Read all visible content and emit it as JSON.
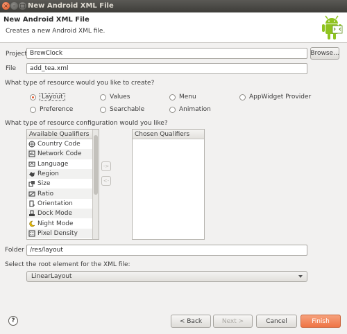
{
  "window": {
    "title": "New Android XML File",
    "close_glyph": "×",
    "min_glyph": "–",
    "max_glyph": "□"
  },
  "header": {
    "title": "New Android XML File",
    "description": "Creates a new Android XML file."
  },
  "project": {
    "label": "Project",
    "value": "BrewClock",
    "browse_label": "Browse..."
  },
  "file": {
    "label": "File",
    "value": "add_tea.xml"
  },
  "resource_type": {
    "prompt": "What type of resource would you like to create?",
    "options": [
      "Layout",
      "Values",
      "Menu",
      "AppWidget Provider",
      "Preference",
      "Searchable",
      "Animation"
    ],
    "selected": "Layout"
  },
  "qualifiers": {
    "prompt": "What type of resource configuration would you like?",
    "available_header": "Available Qualifiers",
    "chosen_header": "Chosen Qualifiers",
    "available": [
      "Country Code",
      "Network Code",
      "Language",
      "Region",
      "Size",
      "Ratio",
      "Orientation",
      "Dock Mode",
      "Night Mode",
      "Pixel Density"
    ],
    "add_glyph": "->",
    "remove_glyph": "<-"
  },
  "folder": {
    "label": "Folder",
    "value": "/res/layout"
  },
  "root_element": {
    "prompt": "Select the root element for the XML file:",
    "value": "LinearLayout"
  },
  "footer": {
    "help_glyph": "?",
    "back_label": "< Back",
    "next_label": "Next >",
    "cancel_label": "Cancel",
    "finish_label": "Finish"
  },
  "icons": {
    "header": "android-robot-icon",
    "qualifiers": [
      "globe-icon",
      "network-icon",
      "language-icon",
      "region-icon",
      "size-icon",
      "ratio-icon",
      "orientation-icon",
      "dock-icon",
      "night-icon",
      "density-icon"
    ]
  },
  "colors": {
    "accent": "#e2552a",
    "finish_button": "#ef7445",
    "android_green": "#8fc31f"
  }
}
